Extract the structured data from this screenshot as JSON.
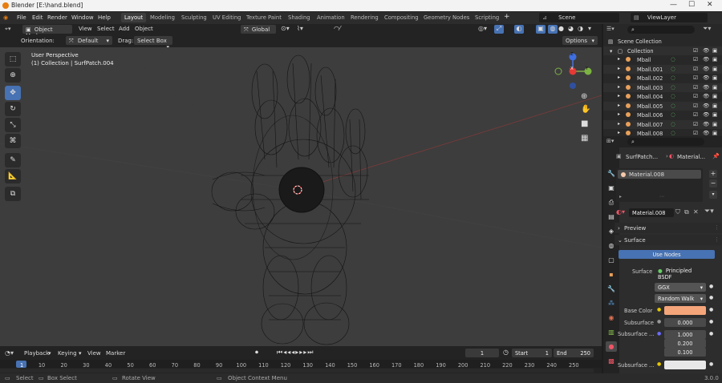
{
  "window": {
    "title": "Blender [E:\\hand.blend]",
    "min": "—",
    "max": "☐",
    "close": "✕"
  },
  "menus": [
    "File",
    "Edit",
    "Render",
    "Window",
    "Help"
  ],
  "workspaces": [
    "Layout",
    "Modeling",
    "Sculpting",
    "UV Editing",
    "Texture Paint",
    "Shading",
    "Animation",
    "Rendering",
    "Compositing",
    "Geometry Nodes",
    "Scripting"
  ],
  "workspace_add": "+",
  "scene": {
    "name": "Scene",
    "view_layer": "ViewLayer"
  },
  "viewport_header": {
    "mode": "Object Mode",
    "menus": [
      "View",
      "Select",
      "Add",
      "Object"
    ],
    "transform": "Global"
  },
  "tool_settings": {
    "orientation_label": "Orientation:",
    "orientation": "Default",
    "drag_label": "Drag:",
    "drag": "Select Box",
    "options": "Options"
  },
  "viewport": {
    "perspective": "User Perspective",
    "collection": "(1) Collection | SurfPatch.004"
  },
  "gizmo": {
    "z": "Z",
    "x": "X",
    "y": "Y"
  },
  "outliner": {
    "root": "Scene Collection",
    "collection": "Collection",
    "items": [
      "Mball",
      "Mball.001",
      "Mball.002",
      "Mball.003",
      "Mball.004",
      "Mball.005",
      "Mball.006",
      "Mball.007",
      "Mball.008"
    ]
  },
  "properties": {
    "breadcrumb_object": "SurfPatch...",
    "breadcrumb_material": "Material...",
    "slot": "Material.008",
    "material_name": "Material.008",
    "preview_label": "Preview",
    "surface_section": "Surface",
    "use_nodes": "Use Nodes",
    "surface_label": "Surface",
    "surface_value": "Principled BSDF",
    "distribution": "GGX",
    "subsurface_method": "Random Walk",
    "base_color_label": "Base Color",
    "base_color": "#f5a57a",
    "subsurface_label": "Subsurface",
    "subsurface_value": "0.000",
    "subsurface_radius_label": "Subsurface ...",
    "radius_values": [
      "1.000",
      "0.200",
      "0.100"
    ],
    "subsurface_color_label": "Subsurface ..."
  },
  "timeline": {
    "menus": [
      "Playback",
      "Keying",
      "View",
      "Marker"
    ],
    "current_frame": "1",
    "start_label": "Start",
    "start": "1",
    "end_label": "End",
    "end": "250",
    "ticks": [
      "1",
      "10",
      "20",
      "30",
      "40",
      "50",
      "60",
      "70",
      "80",
      "90",
      "100",
      "110",
      "120",
      "130",
      "140",
      "150",
      "160",
      "170",
      "180",
      "190",
      "200",
      "210",
      "220",
      "230",
      "240",
      "250"
    ]
  },
  "status": {
    "select": "Select",
    "box_select": "Box Select",
    "rotate_view": "Rotate View",
    "context_menu": "Object Context Menu",
    "version": "3.0.0"
  },
  "colors": {
    "accent": "#4772b3",
    "active_orange": "#e87d0d"
  }
}
